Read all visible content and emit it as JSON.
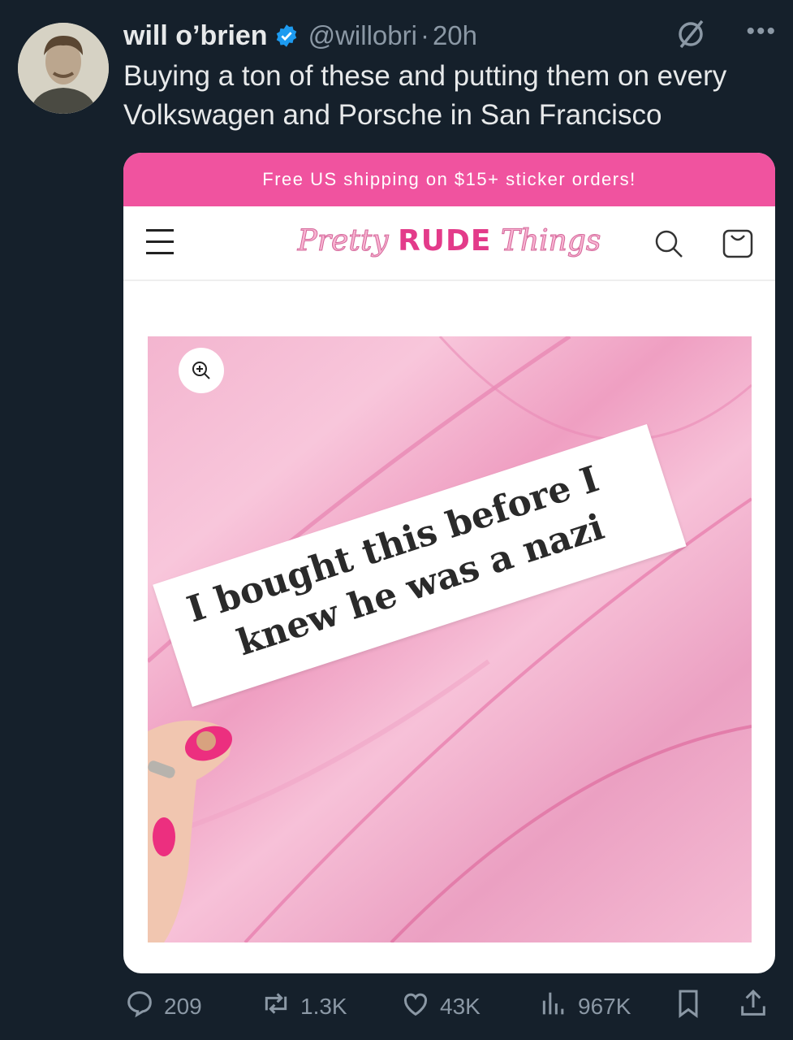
{
  "tweet": {
    "display_name": "will o’brien",
    "handle": "@willobri",
    "separator": "·",
    "time": "20h",
    "text": "Buying a ton of these and putting them on every Volkswagen and Porsche in San Francisco"
  },
  "card": {
    "banner": "Free US shipping on $15+ sticker orders!",
    "logo": {
      "pretty": "Pretty",
      "rude": "RUDE",
      "things": "Things"
    },
    "sticker": {
      "line1": "I bought this before I",
      "line2": "knew he was a nazi"
    }
  },
  "actions": {
    "replies": "209",
    "reposts": "1.3K",
    "likes": "43K",
    "views": "967K"
  },
  "colors": {
    "background": "#15202b",
    "verified": "#1d9bf0",
    "banner": "#f0539f",
    "muted": "#8b98a5"
  },
  "icons": [
    "more-icon",
    "grok-icon",
    "verified-icon",
    "menu-icon",
    "search-icon",
    "cart-icon",
    "zoom-icon",
    "reply-icon",
    "repost-icon",
    "like-icon",
    "views-icon",
    "bookmark-icon",
    "share-icon"
  ]
}
